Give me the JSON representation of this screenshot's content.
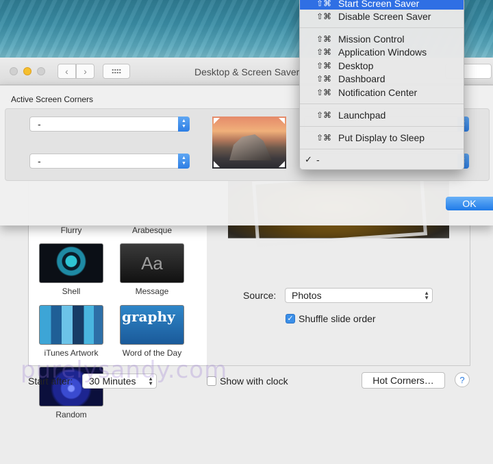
{
  "window": {
    "title": "Desktop & Screen Saver"
  },
  "hot_corners": {
    "section_title": "Active Screen Corners",
    "top_left": "-",
    "bottom_left": "-",
    "top_right": "",
    "bottom_right": "-",
    "ok_label": "OK"
  },
  "menu": {
    "modifier": "⇧⌘",
    "items": [
      {
        "label": "Start Screen Saver",
        "highlighted": true
      },
      {
        "label": "Disable Screen Saver"
      },
      {
        "label": "Mission Control"
      },
      {
        "label": "Application Windows"
      },
      {
        "label": "Desktop"
      },
      {
        "label": "Dashboard"
      },
      {
        "label": "Notification Center"
      },
      {
        "label": "Launchpad"
      },
      {
        "label": "Put Display to Sleep"
      }
    ],
    "selected": {
      "check": "✓",
      "label": "-"
    }
  },
  "savers": [
    {
      "name": "Flurry"
    },
    {
      "name": "Arabesque"
    },
    {
      "name": "Shell"
    },
    {
      "name": "Message",
      "thumb_text": "Aa"
    },
    {
      "name": "iTunes Artwork"
    },
    {
      "name": "Word of the Day",
      "thumb_text": "graphy"
    },
    {
      "name": "Random"
    }
  ],
  "options": {
    "source_label": "Source:",
    "source_value": "Photos",
    "shuffle_label": "Shuffle slide order",
    "shuffle_checked": true,
    "start_after_label": "Start after:",
    "start_after_value": "30 Minutes",
    "show_clock_label": "Show with clock",
    "show_clock_checked": false,
    "hot_corners_button": "Hot Corners…",
    "help_symbol": "?"
  },
  "watermark": "purelysandy.com",
  "colors": {
    "accent": "#2f6fe4",
    "ok_button": "#1f7ae8",
    "minimize_button": "#f5bf2e"
  }
}
